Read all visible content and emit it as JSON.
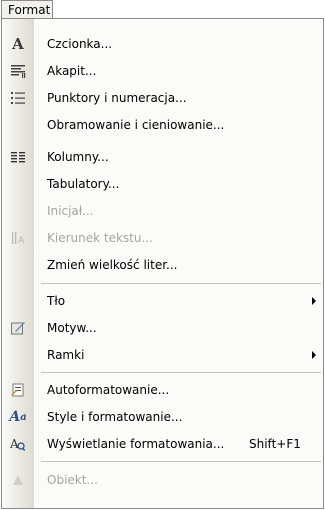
{
  "menubar": {
    "title": "Format"
  },
  "menu": {
    "items": [
      {
        "label": "Czcionka...",
        "icon": "font-a-icon",
        "enabled": true
      },
      {
        "label": "Akapit...",
        "icon": "paragraph-icon",
        "enabled": true
      },
      {
        "label": "Punktory i numeracja...",
        "icon": "bullets-icon",
        "enabled": true
      },
      {
        "label": "Obramowanie i cieniowanie...",
        "icon": null,
        "enabled": true
      },
      {
        "label": "Kolumny...",
        "icon": "columns-icon",
        "enabled": true
      },
      {
        "label": "Tabulatory...",
        "icon": null,
        "enabled": true
      },
      {
        "label": "Inicjał...",
        "icon": null,
        "enabled": false
      },
      {
        "label": "Kierunek tekstu...",
        "icon": "text-direction-icon",
        "enabled": false
      },
      {
        "label": "Zmień wielkość liter...",
        "icon": null,
        "enabled": true
      },
      {
        "label": "Tło",
        "icon": null,
        "enabled": true,
        "submenu": true
      },
      {
        "label": "Motyw...",
        "icon": "theme-icon",
        "enabled": true
      },
      {
        "label": "Ramki",
        "icon": null,
        "enabled": true,
        "submenu": true
      },
      {
        "label": "Autoformatowanie...",
        "icon": "autoformat-icon",
        "enabled": true
      },
      {
        "label": "Style i formatowanie...",
        "icon": "styles-icon",
        "enabled": true
      },
      {
        "label": "Wyświetlanie formatowania...",
        "shortcut": "Shift+F1",
        "icon": "reveal-formatting-icon",
        "enabled": true
      },
      {
        "label": "Obiekt...",
        "icon": "object-icon",
        "enabled": false
      }
    ]
  },
  "colors": {
    "gutter": "#dedbd2",
    "disabled_text": "#a5a5a5",
    "border": "#8a8a8a"
  }
}
